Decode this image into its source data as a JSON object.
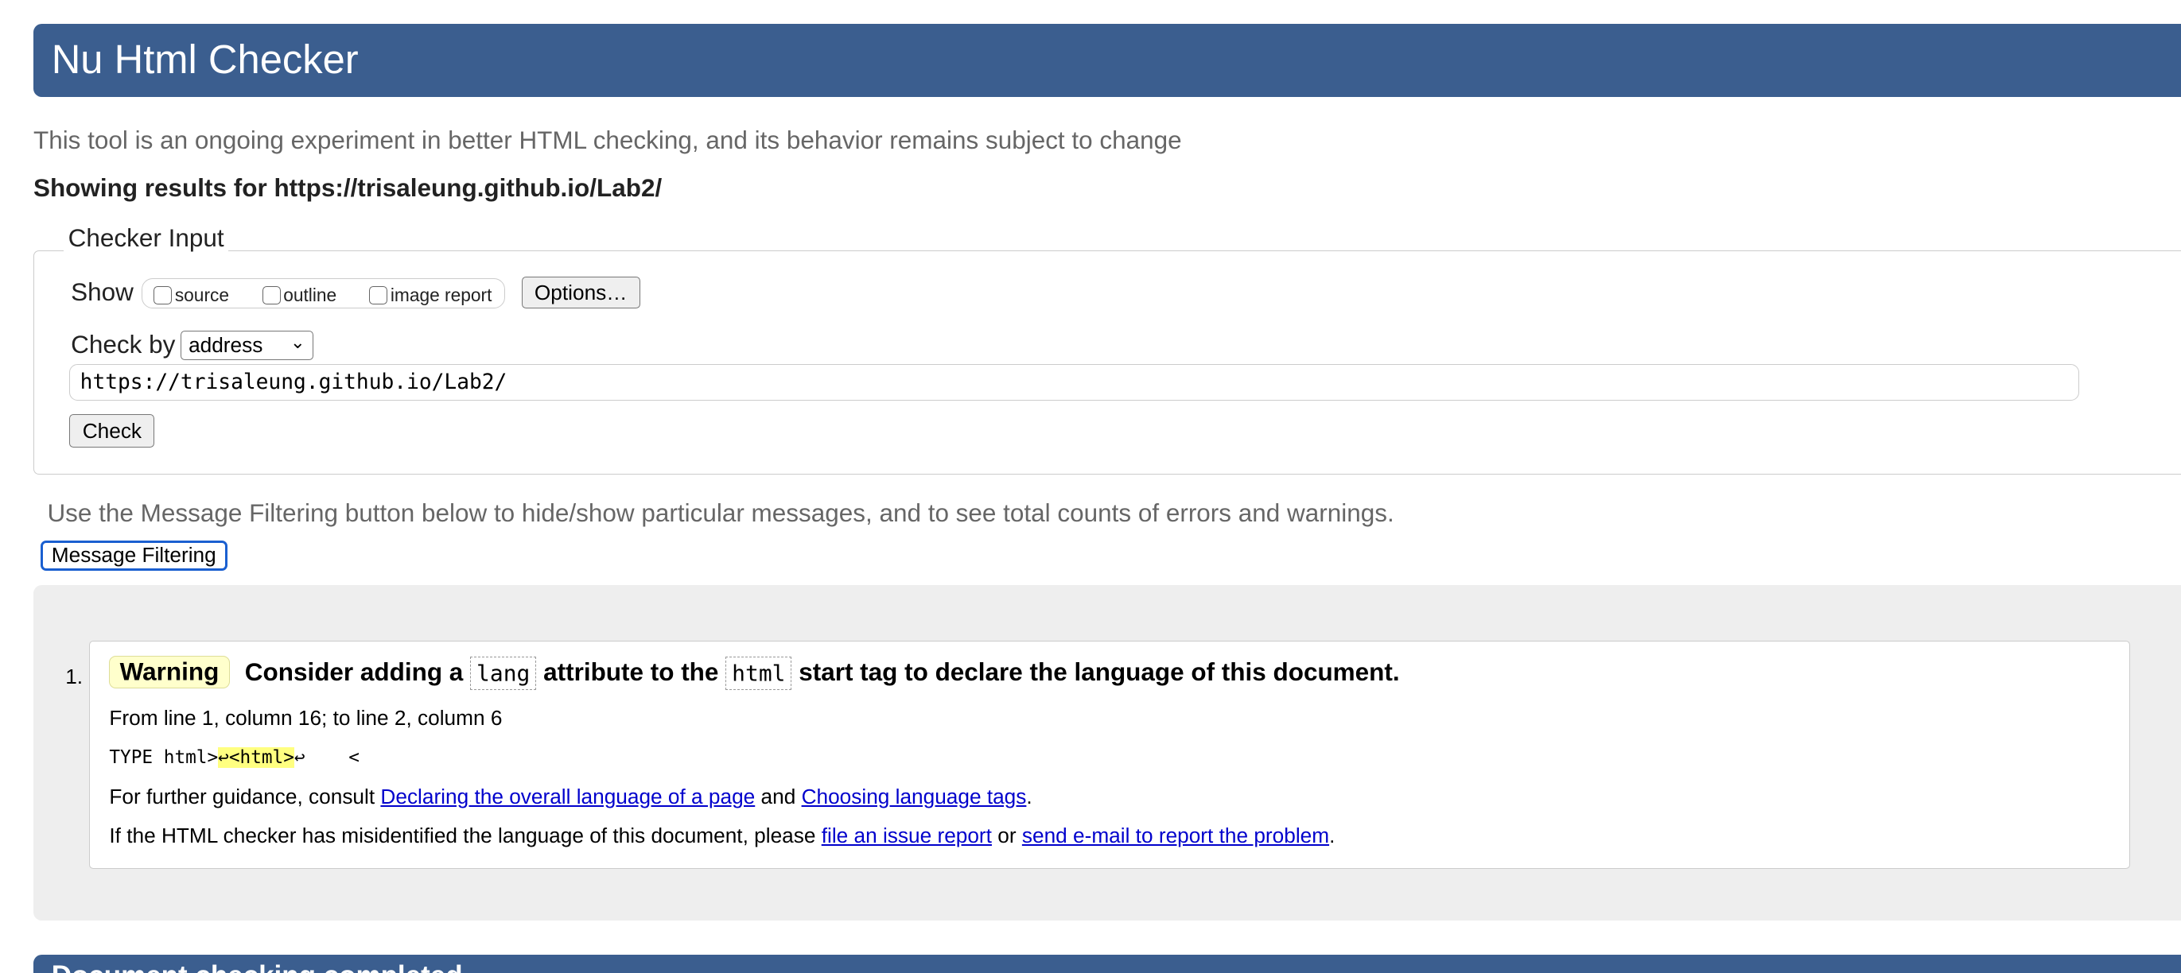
{
  "header": {
    "title": "Nu Html Checker"
  },
  "intro": "This tool is an ongoing experiment in better HTML checking, and its behavior remains subject to change",
  "showing": "Showing results for https://trisaleung.github.io/Lab2/",
  "checker_input": {
    "legend": "Checker Input",
    "show_label": "Show",
    "show_options": [
      {
        "label": "source",
        "checked": false
      },
      {
        "label": "outline",
        "checked": false
      },
      {
        "label": "image report",
        "checked": false
      }
    ],
    "options_button": "Options…",
    "check_by_label": "Check by",
    "check_by_value": "address",
    "url_value": "https://trisaleung.github.io/Lab2/",
    "check_button": "Check"
  },
  "filter_hint": "Use the Message Filtering button below to hide/show particular messages, and to see total counts of errors and warnings.",
  "filter_button": "Message Filtering",
  "messages": [
    {
      "number": "1.",
      "type": "Warning",
      "title_parts": [
        "Consider adding a",
        "lang",
        "attribute to the",
        "html",
        "start tag to declare the language of this document."
      ],
      "location": "From line 1, column 16; to line 2, column 6",
      "extract": {
        "before": "TYPE html>",
        "highlight": "↩<html>",
        "after": "↩    <"
      },
      "guidance": {
        "text1": "For further guidance, consult",
        "link1": "Declaring the overall language of a page",
        "text2": "and",
        "link2": "Choosing language tags",
        "text3": "."
      },
      "report": {
        "text1": "If the HTML checker has misidentified the language of this document, please",
        "link1": "file an issue report",
        "text2": "or",
        "link2": "send e-mail to report the problem",
        "text3": "."
      }
    }
  ],
  "footer_header": {
    "title": "Document checking completed."
  },
  "colors": {
    "header": "#3b5e8f",
    "warning_bg": "#ffffcc",
    "highlight": "#ffff80",
    "link": "#0000cc",
    "panel": "#eeeeee"
  }
}
